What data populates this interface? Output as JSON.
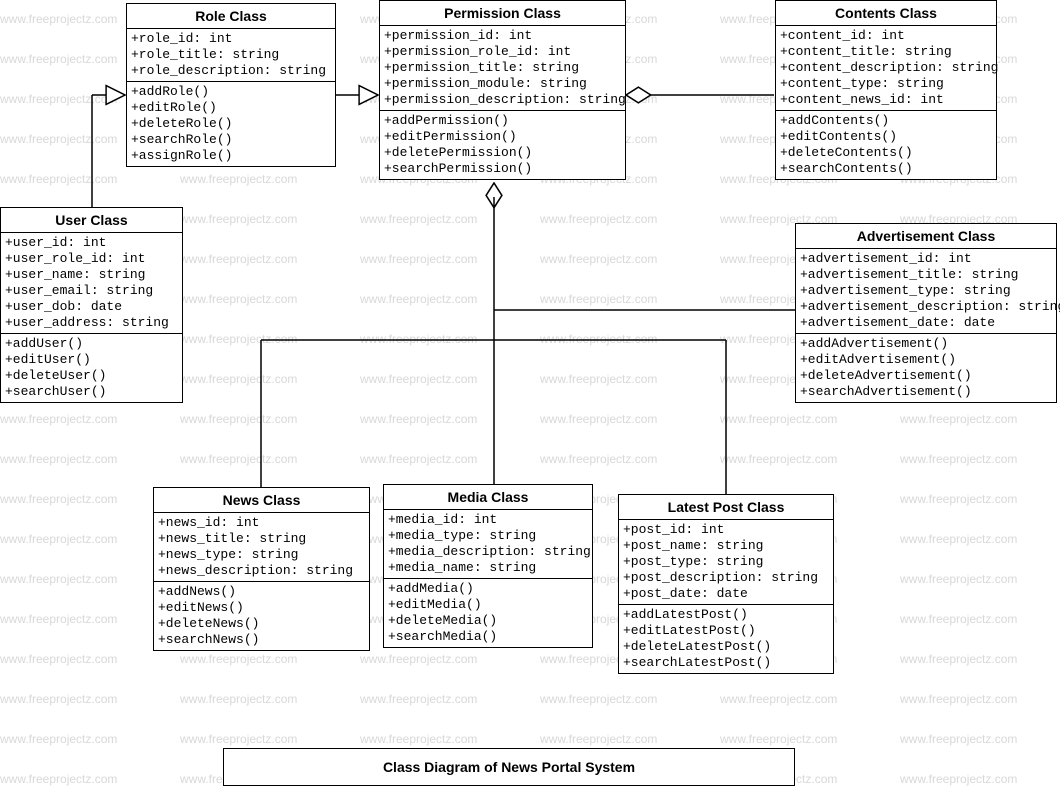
{
  "watermark_text": "www.freeprojectz.com",
  "caption": "Class Diagram of News Portal System",
  "classes": {
    "role": {
      "title": "Role Class",
      "attrs": [
        "+role_id: int",
        "+role_title: string",
        "+role_description: string"
      ],
      "ops": [
        "+addRole()",
        "+editRole()",
        "+deleteRole()",
        "+searchRole()",
        "+assignRole()"
      ]
    },
    "permission": {
      "title": "Permission Class",
      "attrs": [
        "+permission_id: int",
        "+permission_role_id: int",
        "+permission_title: string",
        "+permission_module: string",
        "+permission_description: string"
      ],
      "ops": [
        "+addPermission()",
        "+editPermission()",
        "+deletePermission()",
        "+searchPermission()"
      ]
    },
    "contents": {
      "title": "Contents Class",
      "attrs": [
        "+content_id: int",
        "+content_title: string",
        "+content_description: string",
        "+content_type: string",
        "+content_news_id: int"
      ],
      "ops": [
        "+addContents()",
        "+editContents()",
        "+deleteContents()",
        "+searchContents()"
      ]
    },
    "user": {
      "title": "User Class",
      "attrs": [
        "+user_id: int",
        "+user_role_id: int",
        "+user_name: string",
        "+user_email: string",
        "+user_dob: date",
        "+user_address: string"
      ],
      "ops": [
        "+addUser()",
        "+editUser()",
        "+deleteUser()",
        "+searchUser()"
      ]
    },
    "advertisement": {
      "title": "Advertisement Class",
      "attrs": [
        "+advertisement_id: int",
        "+advertisement_title: string",
        "+advertisement_type: string",
        "+advertisement_description: string",
        "+advertisement_date: date"
      ],
      "ops": [
        "+addAdvertisement()",
        "+editAdvertisement()",
        "+deleteAdvertisement()",
        "+searchAdvertisement()"
      ]
    },
    "news": {
      "title": "News Class",
      "attrs": [
        "+news_id: int",
        "+news_title: string",
        "+news_type: string",
        "+news_description:  string"
      ],
      "ops": [
        "+addNews()",
        "+editNews()",
        "+deleteNews()",
        "+searchNews()"
      ]
    },
    "media": {
      "title": "Media Class",
      "attrs": [
        "+media_id: int",
        "+media_type: string",
        "+media_description: string",
        "+media_name: string"
      ],
      "ops": [
        "+addMedia()",
        "+editMedia()",
        "+deleteMedia()",
        "+searchMedia()"
      ]
    },
    "latestpost": {
      "title": "Latest Post Class",
      "attrs": [
        "+post_id: int",
        "+post_name: string",
        "+post_type: string",
        "+post_description: string",
        "+post_date: date"
      ],
      "ops": [
        "+addLatestPost()",
        "+editLatestPost()",
        "+deleteLatestPost()",
        "+searchLatestPost()"
      ]
    }
  }
}
